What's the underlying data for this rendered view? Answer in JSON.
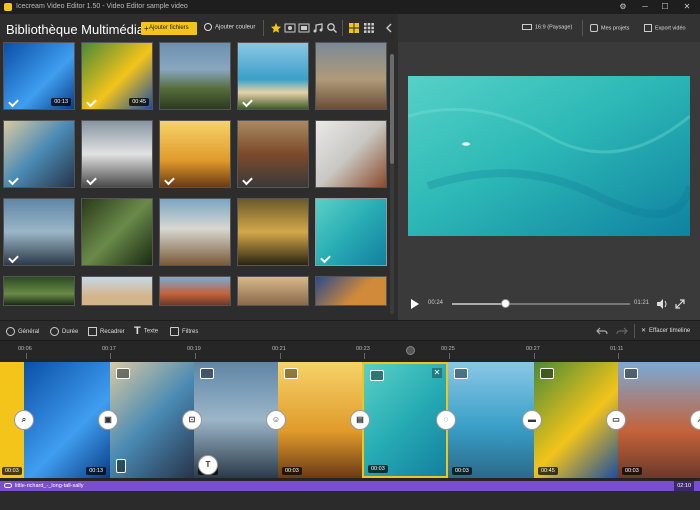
{
  "window": {
    "title": "Icecream Video Editor 1.50 - Video Editor sample video"
  },
  "library": {
    "title": "Bibliothèque Multimédia",
    "add_files": "Ajouter fichiers",
    "add_color": "Ajouter couleur",
    "thumbnails": [
      {
        "duration": "00:13",
        "checked": true
      },
      {
        "duration": "00:45",
        "checked": true
      },
      {
        "duration": "",
        "checked": false
      },
      {
        "duration": "",
        "checked": true
      },
      {
        "duration": "",
        "checked": false
      },
      {
        "duration": "",
        "checked": true
      },
      {
        "duration": "",
        "checked": true
      },
      {
        "duration": "",
        "checked": true
      },
      {
        "duration": "",
        "checked": true
      },
      {
        "duration": "",
        "checked": false
      },
      {
        "duration": "",
        "checked": true
      },
      {
        "duration": "",
        "checked": false
      },
      {
        "duration": "",
        "checked": false
      },
      {
        "duration": "",
        "checked": false
      },
      {
        "duration": "",
        "checked": true
      },
      {
        "duration": "",
        "checked": false
      },
      {
        "duration": "",
        "checked": false
      },
      {
        "duration": "",
        "checked": false
      },
      {
        "duration": "",
        "checked": false
      },
      {
        "duration": "",
        "checked": false
      }
    ]
  },
  "preview_bar": {
    "aspect": "16:9 (Paysage)",
    "projects": "Mes projets",
    "export": "Export vidéo"
  },
  "player": {
    "current": "00:24",
    "total": "01:21",
    "progress": 0.3
  },
  "toolbar": {
    "general": "Général",
    "duration": "Durée",
    "crop": "Recadrer",
    "text": "Texte",
    "filters": "Filtres",
    "clear": "Effacer timeline"
  },
  "ruler": [
    "00:06",
    "00:17",
    "00:19",
    "00:21",
    "00:23",
    "00:25",
    "00:27",
    "01:11"
  ],
  "clips": [
    {
      "duration": "00:03"
    },
    {
      "duration": "00:13"
    },
    {
      "duration": ""
    },
    {
      "duration": "00:03"
    },
    {
      "duration": "00:03"
    },
    {
      "duration": "00:03"
    },
    {
      "duration": "00:03"
    },
    {
      "duration": "00:45"
    },
    {
      "duration": "00:03"
    }
  ],
  "audio": {
    "name": "little-richard_-_long-tall-sally",
    "duration": "02:10"
  },
  "colors": {
    "accent": "#f3c51b",
    "audio": "#7a4fcf"
  }
}
